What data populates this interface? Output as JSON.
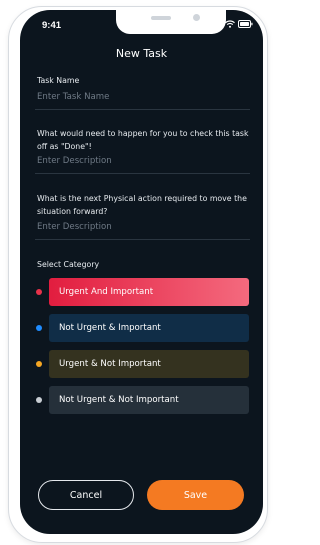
{
  "status_bar": {
    "time": "9:41"
  },
  "header": {
    "title": "New Task"
  },
  "form": {
    "task_name": {
      "label": "Task Name",
      "placeholder": "Enter Task Name"
    },
    "done_criteria": {
      "label": "What would need to happen for you to check this task off as \"Done\"!",
      "placeholder": "Enter Description"
    },
    "next_action": {
      "label": "What is the next Physical action required to move the situation forward?",
      "placeholder": "Enter Description"
    }
  },
  "category": {
    "label": "Select Category",
    "options": [
      {
        "label": "Urgent And Important",
        "dot_color": "#e8324a",
        "selected": true
      },
      {
        "label": "Not Urgent & Important",
        "dot_color": "#1f8cff",
        "selected": false
      },
      {
        "label": "Urgent & Not Important",
        "dot_color": "#f5a623",
        "selected": false
      },
      {
        "label": "Not Urgent & Not Important",
        "dot_color": "#c9ced4",
        "selected": false
      }
    ]
  },
  "actions": {
    "cancel_label": "Cancel",
    "save_label": "Save"
  },
  "colors": {
    "background": "#0c151e",
    "accent": "#f47a22"
  }
}
